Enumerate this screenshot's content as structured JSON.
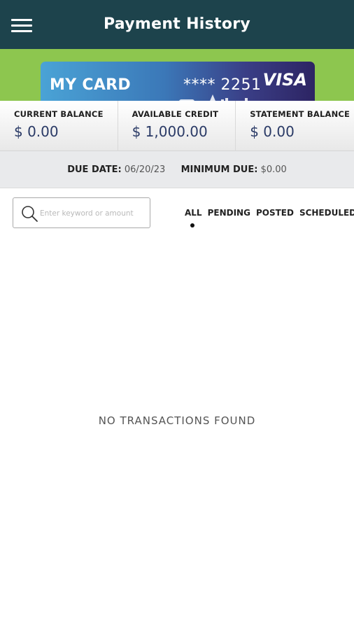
{
  "header": {
    "title": "Payment History",
    "menu_icon": "hamburger-menu-icon"
  },
  "card": {
    "name": "MY CARD",
    "number": "**** 2251",
    "brand": "VISA"
  },
  "balances": [
    {
      "label": "CURRENT BALANCE",
      "value": "$ 0.00"
    },
    {
      "label": "AVAILABLE CREDIT",
      "value": "$ 1,000.00"
    },
    {
      "label": "STATEMENT BALANCE",
      "value": "$ 0.00"
    }
  ],
  "due": {
    "due_date_label": "DUE DATE:",
    "due_date_value": "06/20/23",
    "minimum_due_label": "MINIMUM DUE:",
    "minimum_due_value": "$0.00"
  },
  "search": {
    "placeholder": "Enter keyword or amount",
    "value": "",
    "icon": "search-icon"
  },
  "filters": {
    "items": [
      "ALL",
      "PENDING",
      "POSTED",
      "SCHEDULED"
    ],
    "selected": "ALL"
  },
  "empty_message": "NO TRANSACTIONS FOUND",
  "colors": {
    "header_bg": "#1d434c",
    "accent_green": "#8dc64f",
    "balance_value": "#2a3a66"
  }
}
